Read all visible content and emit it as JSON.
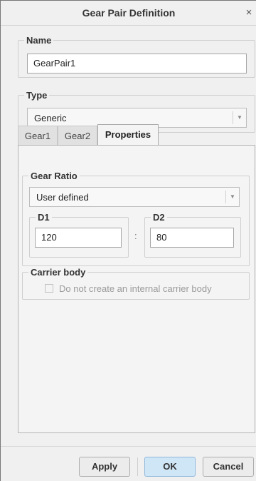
{
  "dialog": {
    "title": "Gear Pair Definition",
    "close_glyph": "×"
  },
  "name_group": {
    "label": "Name",
    "value": "GearPair1"
  },
  "type_group": {
    "label": "Type",
    "selected": "Generic",
    "arrow": "▼"
  },
  "tabs": [
    {
      "label": "Gear1"
    },
    {
      "label": "Gear2"
    },
    {
      "label": "Properties"
    }
  ],
  "gear_ratio": {
    "label": "Gear Ratio",
    "selected": "User defined",
    "arrow": "▼",
    "d1": {
      "label": "D1",
      "value": "120"
    },
    "separator": ":",
    "d2": {
      "label": "D2",
      "value": "80"
    }
  },
  "carrier_body": {
    "label": "Carrier body",
    "checkbox_label": "Do not create an internal carrier body"
  },
  "buttons": {
    "apply": "Apply",
    "ok": "OK",
    "cancel": "Cancel"
  }
}
